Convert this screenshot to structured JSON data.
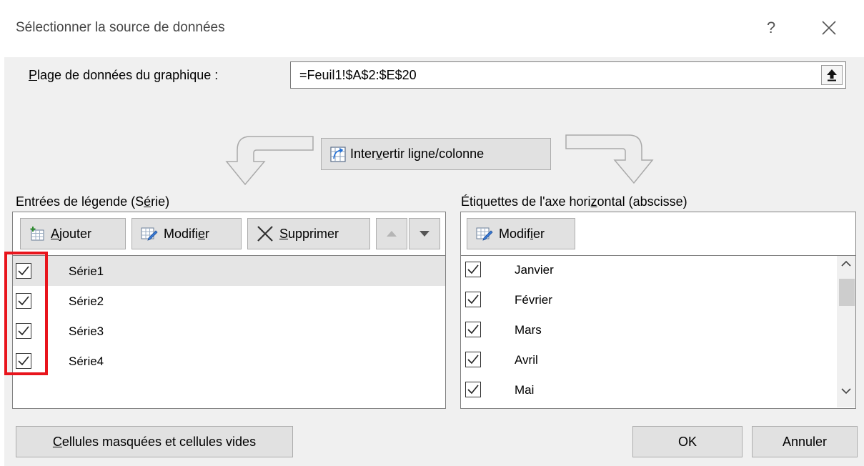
{
  "dialog": {
    "title": "Sélectionner la source de données",
    "help_label": "?",
    "close_label": "×"
  },
  "range": {
    "label_u": "P",
    "label_rest": "lage de données du graphique :",
    "value": "=Feuil1!$A$2:$E$20"
  },
  "switch": {
    "label_pre": "Inter",
    "label_u": "v",
    "label_post": "ertir ligne/colonne"
  },
  "legend": {
    "label_pre": "Entrées de légende (S",
    "label_u": "é",
    "label_post": "rie)",
    "add_u": "A",
    "add_rest": "jouter",
    "edit_pre": "Modifi",
    "edit_u": "e",
    "edit_post": "r",
    "delete_u": "S",
    "delete_rest": "upprimer",
    "series": [
      {
        "label": "Série1",
        "checked": true,
        "selected": true
      },
      {
        "label": "Série2",
        "checked": true,
        "selected": false
      },
      {
        "label": "Série3",
        "checked": true,
        "selected": false
      },
      {
        "label": "Série4",
        "checked": true,
        "selected": false
      }
    ]
  },
  "axis": {
    "label_pre": "Étiquettes de l'axe hori",
    "label_u": "z",
    "label_post": "ontal (abscisse)",
    "edit_pre": "Modif",
    "edit_u": "i",
    "edit_post": "er",
    "items": [
      {
        "label": "Janvier",
        "checked": true
      },
      {
        "label": "Février",
        "checked": true
      },
      {
        "label": "Mars",
        "checked": true
      },
      {
        "label": "Avril",
        "checked": true
      },
      {
        "label": "Mai",
        "checked": true
      }
    ]
  },
  "footer": {
    "hidden_u": "C",
    "hidden_rest": "ellules masquées et cellules vides",
    "ok_label": "OK",
    "cancel_label": "Annuler"
  },
  "colors": {
    "highlight": "#e8141c",
    "dialog_bg": "#f0f0f0",
    "button_bg": "#e1e1e1"
  }
}
